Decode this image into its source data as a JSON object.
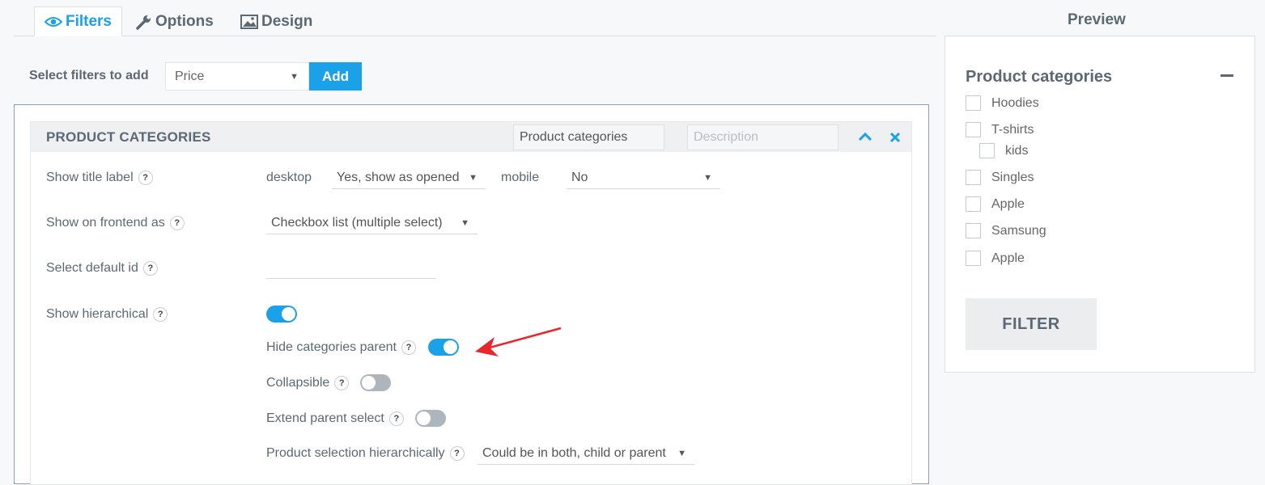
{
  "tabs": [
    {
      "label": "Filters",
      "icon": "eye-icon",
      "active": true
    },
    {
      "label": "Options",
      "icon": "wrench-icon",
      "active": false
    },
    {
      "label": "Design",
      "icon": "image-icon",
      "active": false
    }
  ],
  "select_filters": {
    "label": "Select filters to add",
    "value": "Price",
    "add_label": "Add"
  },
  "filter_block": {
    "title": "PRODUCT CATEGORIES",
    "name_value": "Product categories",
    "description_placeholder": "Description",
    "rows": {
      "show_title_label": {
        "label": "Show title label",
        "desktop_label": "desktop",
        "desktop_value": "Yes, show as opened",
        "mobile_label": "mobile",
        "mobile_value": "No"
      },
      "show_on_frontend": {
        "label": "Show on frontend as",
        "value": "Checkbox list (multiple select)"
      },
      "select_default_id": {
        "label": "Select default id",
        "value": ""
      },
      "show_hierarchical": {
        "label": "Show hierarchical",
        "on": true
      },
      "hide_categories_parent": {
        "label": "Hide categories parent",
        "on": true
      },
      "collapsible": {
        "label": "Collapsible",
        "on": false
      },
      "extend_parent_select": {
        "label": "Extend parent select",
        "on": false
      },
      "product_selection_hierarchically": {
        "label": "Product selection hierarchically",
        "value": "Could be in both, child or parent"
      }
    },
    "help_symbol": "?"
  },
  "preview": {
    "title": "Preview",
    "heading": "Product categories",
    "items": [
      {
        "label": "Hoodies"
      },
      {
        "label": "T-shirts"
      },
      {
        "label": "kids"
      },
      {
        "label": "Singles"
      },
      {
        "label": "Apple"
      },
      {
        "label": "Samsung"
      },
      {
        "label": "Apple"
      }
    ],
    "button_label": "FILTER"
  },
  "colors": {
    "accent": "#1aa1e8",
    "annotation_arrow": "#e8262b",
    "text": "#5c6873"
  }
}
